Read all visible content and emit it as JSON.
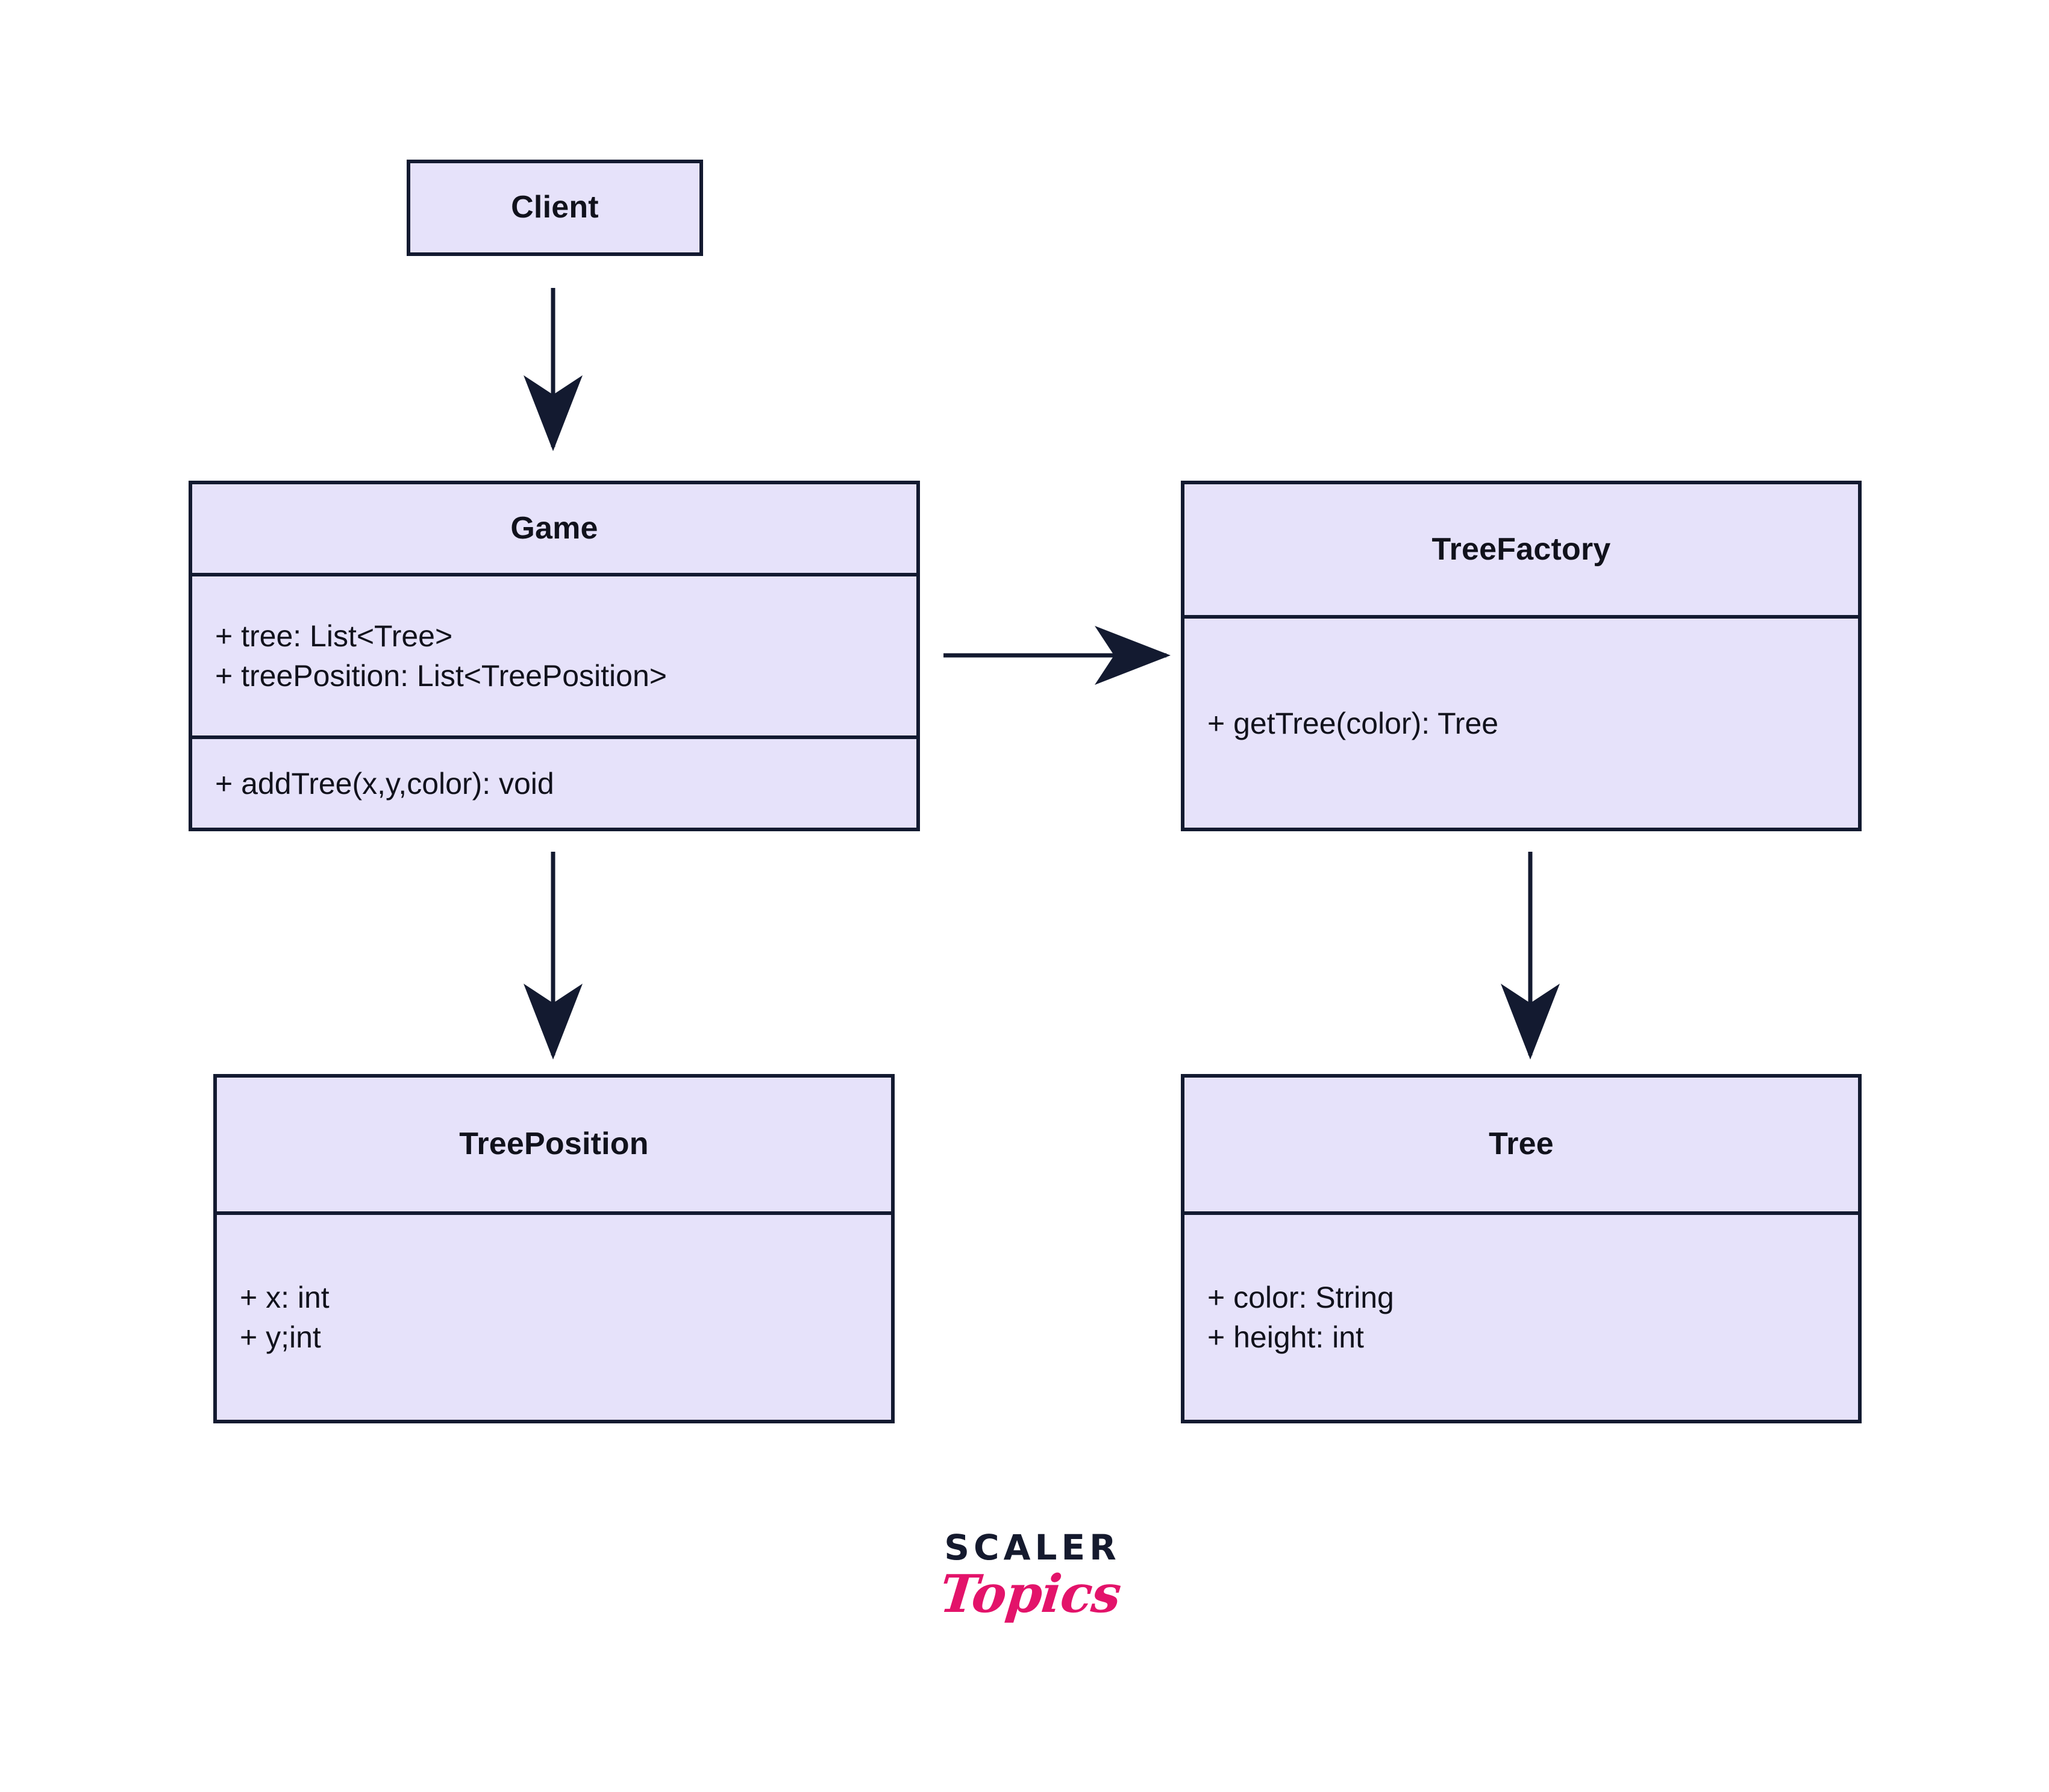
{
  "diagram": {
    "kind": "uml-class-diagram",
    "fill_color": "#e6e2fa",
    "stroke_color": "#131a30",
    "background_color": "#ffffff",
    "classes": [
      {
        "id": "client",
        "name": "Client",
        "attributes": [],
        "methods": []
      },
      {
        "id": "game",
        "name": "Game",
        "attributes": [
          "+ tree: List<Tree>",
          "+ treePosition: List<TreePosition>"
        ],
        "methods": [
          "+ addTree(x,y,color): void"
        ]
      },
      {
        "id": "treefactory",
        "name": "TreeFactory",
        "attributes": [],
        "methods": [
          "+ getTree(color): Tree"
        ]
      },
      {
        "id": "treeposition",
        "name": "TreePosition",
        "attributes": [
          "+ x: int",
          "+ y;int"
        ],
        "methods": []
      },
      {
        "id": "tree",
        "name": "Tree",
        "attributes": [
          "+ color: String",
          "+ height: int"
        ],
        "methods": []
      }
    ],
    "arrows": [
      {
        "id": "client-to-game",
        "from": "client",
        "to": "game",
        "direction": "down"
      },
      {
        "id": "game-to-treefactory",
        "from": "game",
        "to": "treefactory",
        "direction": "right"
      },
      {
        "id": "game-to-treeposition",
        "from": "game",
        "to": "treeposition",
        "direction": "down"
      },
      {
        "id": "treefactory-to-tree",
        "from": "treefactory",
        "to": "tree",
        "direction": "down"
      }
    ]
  },
  "brand": {
    "primary": "SCALER",
    "secondary": "Topics",
    "primary_color": "#151a2e",
    "secondary_color": "#e3136a"
  }
}
